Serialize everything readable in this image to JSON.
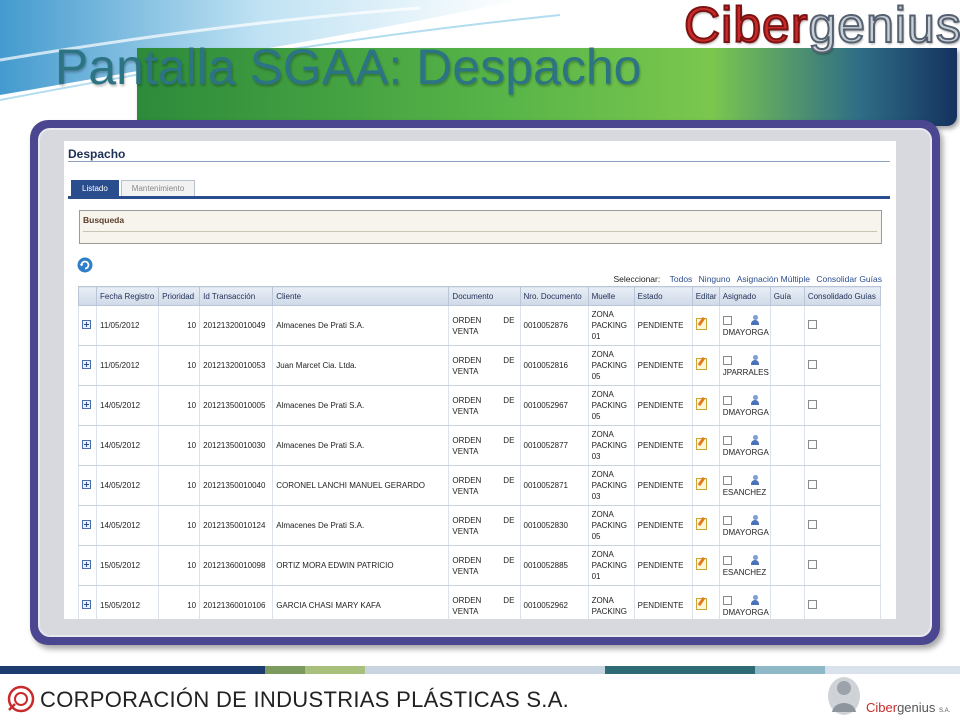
{
  "slide": {
    "title": "Pantalla SGAA: Despacho",
    "brand_logo_part1": "Ciber",
    "brand_logo_part2": "genius"
  },
  "app": {
    "title": "Despacho",
    "tabs": [
      {
        "label": "Listado",
        "active": true
      },
      {
        "label": "Mantenimiento",
        "active": false
      }
    ],
    "search": {
      "label": "Busqueda"
    },
    "selector": {
      "label": "Seleccionar:",
      "todos": "Todos",
      "ninguno": "Ninguno",
      "asignacion_multiple": "Asignación Múltiple",
      "consolidar_guias": "Consolidar Guías"
    },
    "table": {
      "headers": [
        "Fecha Registro",
        "Prioridad",
        "Id Transacción",
        "Cliente",
        "Documento",
        "Nro. Documento",
        "Muelle",
        "Estado",
        "Editar",
        "Asignado",
        "Guía",
        "Consolidado Guías"
      ],
      "rows": [
        {
          "fecha": "11/05/2012",
          "prioridad": "10",
          "id": "20121320010049",
          "cliente": "Almacenes De Prati S.A.",
          "doc_a": "ORDEN",
          "doc_b": "DE",
          "doc_c": "VENTA",
          "nro": "0010052876",
          "muelle_a": "ZONA",
          "muelle_b": "PACKING",
          "muelle_c": "01",
          "estado": "PENDIENTE",
          "asignado": "DMAYORGA"
        },
        {
          "fecha": "11/05/2012",
          "prioridad": "10",
          "id": "20121320010053",
          "cliente": "Juan Marcet Cia. Ltda.",
          "doc_a": "ORDEN",
          "doc_b": "DE",
          "doc_c": "VENTA",
          "nro": "0010052816",
          "muelle_a": "ZONA",
          "muelle_b": "PACKING",
          "muelle_c": "05",
          "estado": "PENDIENTE",
          "asignado": "JPARRALES"
        },
        {
          "fecha": "14/05/2012",
          "prioridad": "10",
          "id": "20121350010005",
          "cliente": "Almacenes De Prati S.A.",
          "doc_a": "ORDEN",
          "doc_b": "DE",
          "doc_c": "VENTA",
          "nro": "0010052967",
          "muelle_a": "ZONA",
          "muelle_b": "PACKING",
          "muelle_c": "05",
          "estado": "PENDIENTE",
          "asignado": "DMAYORGA"
        },
        {
          "fecha": "14/05/2012",
          "prioridad": "10",
          "id": "20121350010030",
          "cliente": "Almacenes De Prati S.A.",
          "doc_a": "ORDEN",
          "doc_b": "DE",
          "doc_c": "VENTA",
          "nro": "0010052877",
          "muelle_a": "ZONA",
          "muelle_b": "PACKING",
          "muelle_c": "03",
          "estado": "PENDIENTE",
          "asignado": "DMAYORGA"
        },
        {
          "fecha": "14/05/2012",
          "prioridad": "10",
          "id": "20121350010040",
          "cliente": "CORONEL LANCHI MANUEL GERARDO",
          "doc_a": "ORDEN",
          "doc_b": "DE",
          "doc_c": "VENTA",
          "nro": "0010052871",
          "muelle_a": "ZONA",
          "muelle_b": "PACKING",
          "muelle_c": "03",
          "estado": "PENDIENTE",
          "asignado": "ESANCHEZ"
        },
        {
          "fecha": "14/05/2012",
          "prioridad": "10",
          "id": "20121350010124",
          "cliente": "Almacenes De Prati S.A.",
          "doc_a": "ORDEN",
          "doc_b": "DE",
          "doc_c": "VENTA",
          "nro": "0010052830",
          "muelle_a": "ZONA",
          "muelle_b": "PACKING",
          "muelle_c": "05",
          "estado": "PENDIENTE",
          "asignado": "DMAYORGA"
        },
        {
          "fecha": "15/05/2012",
          "prioridad": "10",
          "id": "20121360010098",
          "cliente": "ORTIZ MORA EDWIN PATRICIO",
          "doc_a": "ORDEN",
          "doc_b": "DE",
          "doc_c": "VENTA",
          "nro": "0010052885",
          "muelle_a": "ZONA",
          "muelle_b": "PACKING",
          "muelle_c": "01",
          "estado": "PENDIENTE",
          "asignado": "ESANCHEZ"
        },
        {
          "fecha": "15/05/2012",
          "prioridad": "10",
          "id": "20121360010106",
          "cliente": "GARCIA CHASI MARY KAFA",
          "doc_a": "ORDEN",
          "doc_b": "DE",
          "doc_c": "VENTA",
          "nro": "0010052962",
          "muelle_a": "ZONA",
          "muelle_b": "PACKING",
          "muelle_c": "",
          "estado": "PENDIENTE",
          "asignado": "DMAYORGA"
        }
      ]
    }
  },
  "footer": {
    "company": "CORPORACIÓN DE INDUSTRIAS PLÁSTICAS S.A.",
    "brand_part1": "Ciber",
    "brand_part2": "genius",
    "brand_suffix": "S.A."
  },
  "colors": {
    "title": "#2c7483",
    "accent": "#2a4d8d",
    "frame": "#4a4790",
    "brand_red": "#c92b2b"
  },
  "icons": {
    "refresh": "refresh-icon",
    "expand": "expand-icon",
    "edit": "edit-icon",
    "assign": "user-icon",
    "checkbox": "checkbox"
  }
}
